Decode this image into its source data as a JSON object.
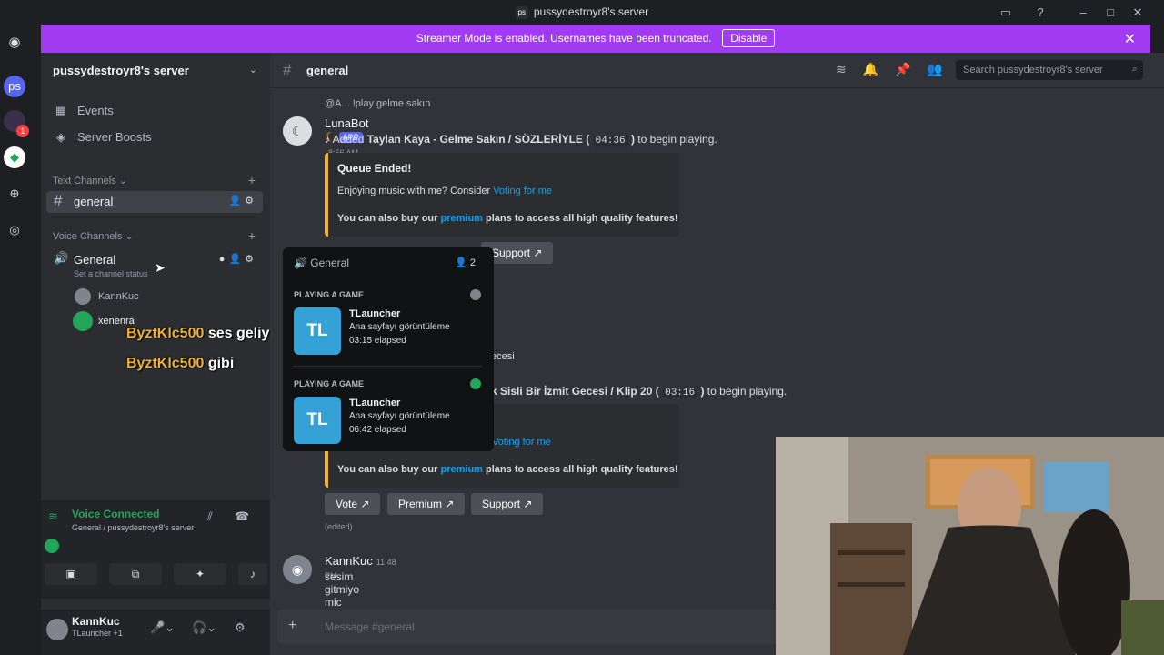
{
  "window": {
    "title": "pussydestroyr8's server",
    "server_short": "ps"
  },
  "banner": {
    "text": "Streamer Mode is enabled. Usernames have been truncated.",
    "button": "Disable"
  },
  "servers": [
    {
      "label": "ps",
      "badge": ""
    },
    {
      "label": "",
      "badge": "1"
    }
  ],
  "sidebar": {
    "server_name": "pussydestroyr8's server",
    "events": "Events",
    "boosts": "Server Boosts",
    "text_category": "Text Channels",
    "text_channel": "general",
    "voice_category": "Voice Channels",
    "voice_channel": "General",
    "voice_status": "Set a channel status",
    "voice_users": [
      "KannKuc",
      "xenenra"
    ]
  },
  "overlay": {
    "line1_user": "ByztKlc500",
    "line1_text": "ses geliyor",
    "line2_user": "ByztKlc500",
    "line2_text": "gibi"
  },
  "voice_panel": {
    "status": "Voice Connected",
    "location": "General / pussydestroyr8's server"
  },
  "user_panel": {
    "name": "KannKuc",
    "status": "TLauncher +1"
  },
  "header": {
    "channel": "general",
    "search_placeholder": "Search pussydestroyr8's server"
  },
  "messages": {
    "reply_preview": "@A... !play gelme sakın",
    "bot_name": "LunaBot",
    "bot_tag": "APP",
    "bot_time": "8:56 AM",
    "added_prefix": "Added",
    "song1": "Taylan Kaya - Gelme Sakın / SÖZLERİYLE",
    "song1_duration": "04:36",
    "added_suffix": "to begin playing.",
    "embed1_title": "Queue Ended!",
    "embed_line1_prefix": "Enjoying music with me? Consider",
    "embed_line1_link": "Voting for me",
    "embed_line2_prefix": "You can also buy our",
    "embed_line2_link": "premium",
    "embed_line2_suffix": "plans to access all high quality features!",
    "support_label": "Support",
    "partial_fragment": "ecesi",
    "song2_partial": "k Sisli Bir İzmit Gecesi / Klip 20",
    "song2_duration": "03:16",
    "vote_link_partial": "Voting for me",
    "vote_button": "Vote",
    "premium_button": "Premium",
    "support_button": "Support",
    "edited": "(edited)",
    "user_name": "KannKuc",
    "user_time": "11:48 PM",
    "user_text": "sesim gitmiyo mic kapalı değil",
    "input_placeholder": "Message #general"
  },
  "popup": {
    "channel": "General",
    "count": "2",
    "activities": [
      {
        "label": "PLAYING A GAME",
        "game": "TLauncher",
        "detail": "Ana sayfayı görüntüleme",
        "elapsed": "03:15 elapsed",
        "icon_text": "TL"
      },
      {
        "label": "PLAYING A GAME",
        "game": "TLauncher",
        "detail": "Ana sayfayı görüntüleme",
        "elapsed": "06:42 elapsed",
        "icon_text": "TL"
      }
    ]
  },
  "colors": {
    "accent": "#5865f2",
    "banner": "#a13bf2",
    "online": "#23a55a",
    "link": "#00a8fc",
    "embed_bar": "#f0b232"
  }
}
